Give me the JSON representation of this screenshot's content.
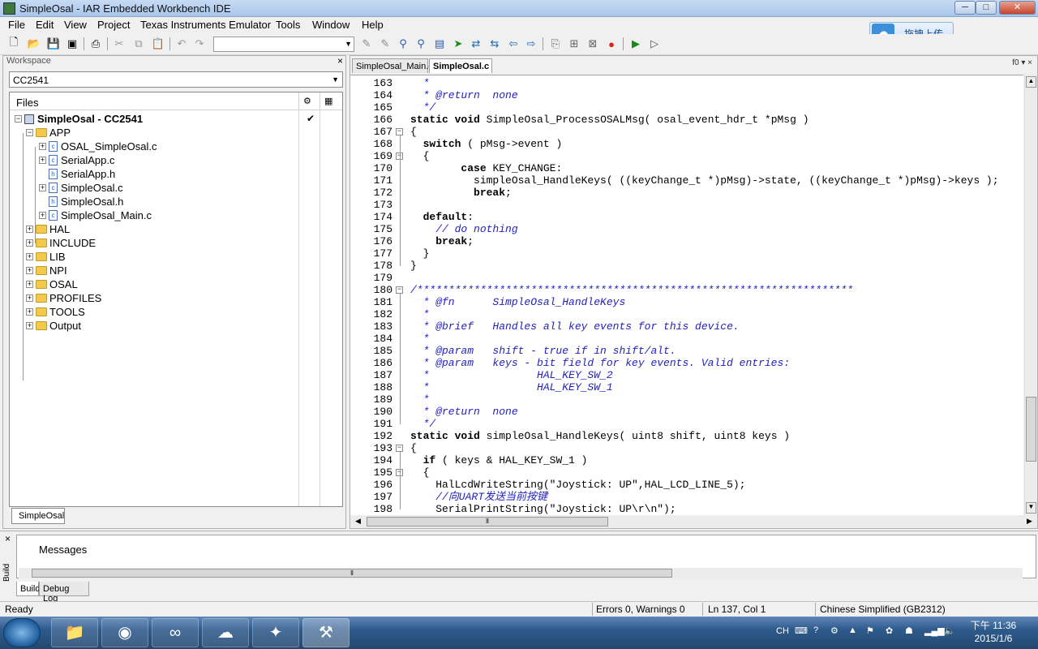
{
  "window": {
    "title": "SimpleOsal - IAR Embedded Workbench IDE",
    "min": "─",
    "max": "□",
    "close": "✕"
  },
  "menu": [
    "File",
    "Edit",
    "View",
    "Project",
    "Texas Instruments Emulator",
    "Tools",
    "Window",
    "Help"
  ],
  "baidu": {
    "label": "拖拽上传"
  },
  "workspace": {
    "header": "Workspace",
    "close": "×",
    "config": "CC2541",
    "files_header": "Files",
    "tab": "SimpleOsal",
    "check": "✔",
    "tree": [
      {
        "label": "SimpleOsal - CC2541",
        "bold": true
      },
      {
        "label": "APP"
      },
      {
        "label": "OSAL_SimpleOsal.c"
      },
      {
        "label": "SerialApp.c"
      },
      {
        "label": "SerialApp.h"
      },
      {
        "label": "SimpleOsal.c"
      },
      {
        "label": "SimpleOsal.h"
      },
      {
        "label": "SimpleOsal_Main.c"
      },
      {
        "label": "HAL"
      },
      {
        "label": "INCLUDE"
      },
      {
        "label": "LIB"
      },
      {
        "label": "NPI"
      },
      {
        "label": "OSAL"
      },
      {
        "label": "PROFILES"
      },
      {
        "label": "TOOLS"
      },
      {
        "label": "Output"
      }
    ]
  },
  "editor": {
    "tabs": [
      "SimpleOsal_Main.c",
      "SimpleOsal.c"
    ],
    "active_tab": "SimpleOsal.c",
    "tab_right": "f0 ▾ ×",
    "lines": [
      {
        "n": "163",
        "t": "  *"
      },
      {
        "n": "164",
        "t": "  * @return  none"
      },
      {
        "n": "165",
        "t": "  */"
      },
      {
        "n": "166",
        "t": "static void SimpleOsal_ProcessOSALMsg( osal_event_hdr_t *pMsg )"
      },
      {
        "n": "167",
        "t": "{"
      },
      {
        "n": "168",
        "t": "  switch ( pMsg->event )"
      },
      {
        "n": "169",
        "t": "  {"
      },
      {
        "n": "170",
        "t": "        case KEY_CHANGE:"
      },
      {
        "n": "171",
        "t": "          simpleOsal_HandleKeys( ((keyChange_t *)pMsg)->state, ((keyChange_t *)pMsg)->keys );"
      },
      {
        "n": "172",
        "t": "          break;"
      },
      {
        "n": "173",
        "t": ""
      },
      {
        "n": "174",
        "t": "  default:"
      },
      {
        "n": "175",
        "t": "    // do nothing"
      },
      {
        "n": "176",
        "t": "    break;"
      },
      {
        "n": "177",
        "t": "  }"
      },
      {
        "n": "178",
        "t": "}"
      },
      {
        "n": "179",
        "t": ""
      },
      {
        "n": "180",
        "t": "/*********************************************************************"
      },
      {
        "n": "181",
        "t": "  * @fn      SimpleOsal_HandleKeys"
      },
      {
        "n": "182",
        "t": "  *"
      },
      {
        "n": "183",
        "t": "  * @brief   Handles all key events for this device."
      },
      {
        "n": "184",
        "t": "  *"
      },
      {
        "n": "185",
        "t": "  * @param   shift - true if in shift/alt."
      },
      {
        "n": "186",
        "t": "  * @param   keys - bit field for key events. Valid entries:"
      },
      {
        "n": "187",
        "t": "  *                 HAL_KEY_SW_2"
      },
      {
        "n": "188",
        "t": "  *                 HAL_KEY_SW_1"
      },
      {
        "n": "189",
        "t": "  *"
      },
      {
        "n": "190",
        "t": "  * @return  none"
      },
      {
        "n": "191",
        "t": "  */"
      },
      {
        "n": "192",
        "t": "static void simpleOsal_HandleKeys( uint8 shift, uint8 keys )"
      },
      {
        "n": "193",
        "t": "{"
      },
      {
        "n": "194",
        "t": "  if ( keys & HAL_KEY_SW_1 )"
      },
      {
        "n": "195",
        "t": "  {"
      },
      {
        "n": "196",
        "t": "    HalLcdWriteString(\"Joystick: UP\",HAL_LCD_LINE_5);"
      },
      {
        "n": "197",
        "t": "    //向UART发送当前按键"
      },
      {
        "n": "198",
        "t": "    SerialPrintString(\"Joystick: UP\\r\\n\");"
      }
    ]
  },
  "messages": {
    "header": "Messages",
    "side": "Build",
    "tabs": [
      "Build",
      "Debug Log"
    ],
    "close": "×"
  },
  "status": {
    "ready": "Ready",
    "errors": "Errors 0, Warnings 0",
    "position": "Ln 137, Col 1",
    "encoding": "Chinese Simplified (GB2312)"
  },
  "taskbar": {
    "lang": "CH",
    "time": "下午 11:36",
    "date": "2015/1/6"
  }
}
